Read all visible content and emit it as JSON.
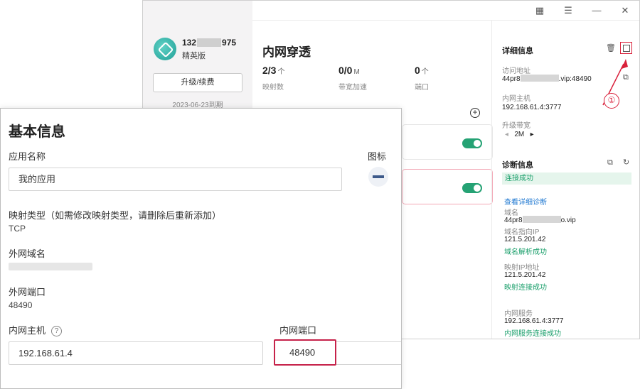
{
  "window": {
    "account": {
      "prefix": "132",
      "suffix": "975",
      "edition": "精英版"
    },
    "upgrade_label": "升级/续费",
    "expire_label": "2023-06-23到期",
    "main": {
      "title": "内网穿透",
      "stats": [
        {
          "num": "2/3",
          "unit": "个",
          "label": "映射数"
        },
        {
          "num": "0/0",
          "unit": "M",
          "label": "带宽加速"
        },
        {
          "num": "0",
          "unit": "个",
          "label": "端口"
        }
      ]
    },
    "detail": {
      "title": "详细信息",
      "access_label": "访问地址",
      "access_prefix": "44pr8",
      "access_suffix": ".vip:48490",
      "host_label": "内网主机",
      "host_value": "192.168.61.4:3777",
      "bandwidth_label": "升级带宽",
      "bandwidth_value": "2M"
    },
    "diag": {
      "title": "诊断信息",
      "status": "连接成功",
      "view_link": "查看详细诊断",
      "domain_label": "域名",
      "domain_prefix": "44pr8",
      "domain_suffix": "o.vip",
      "domain_ip_label": "域名指向IP",
      "domain_ip_value": "121.5.201.42",
      "domain_ok": "域名解析成功",
      "map_ip_label": "映射IP地址",
      "map_ip_value": "121.5.201.42",
      "map_ok": "映射连接成功",
      "svc_label": "内网服务",
      "svc_value": "192.168.61.4:3777",
      "svc_ok": "内网服务连接成功"
    },
    "annotation": "①",
    "accent_color": "#25a274",
    "highlight_color": "#c6224a"
  },
  "dialog": {
    "title": "基本信息",
    "app_name_label": "应用名称",
    "app_name_value": "我的应用",
    "icon_label": "图标",
    "map_type_label": "映射类型（如需修改映射类型，请删除后重新添加）",
    "map_type_value": "TCP",
    "ext_domain_label": "外网域名",
    "ext_port_label": "外网端口",
    "ext_port_value": "48490",
    "int_host_label": "内网主机",
    "int_host_value": "192.168.61.4",
    "int_port_label": "内网端口",
    "int_port_value": "48490"
  }
}
